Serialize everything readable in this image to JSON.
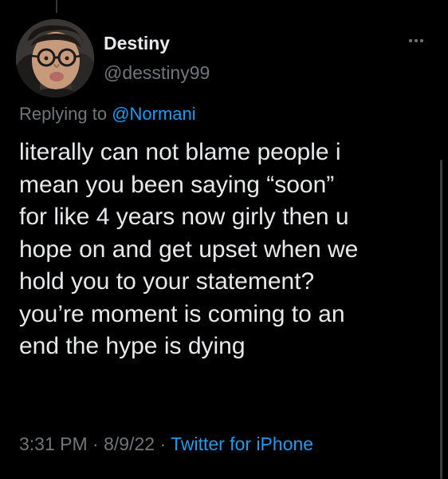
{
  "user": {
    "display_name": "Destiny",
    "handle": "@desstiny99",
    "avatar_icon": "profile-photo"
  },
  "reply": {
    "prefix": "Replying to ",
    "mention": "@Normani"
  },
  "tweet": {
    "lines": [
      "literally can not blame people i",
      "mean you been saying “soon”",
      "for like 4 years now girly then u",
      "hope on and get upset when we",
      "hold you to your statement?",
      "you’re moment is coming to an",
      "end the hype is dying"
    ]
  },
  "meta": {
    "time": "3:31 PM",
    "separator": " · ",
    "date": "8/9/22",
    "source": "Twitter for iPhone"
  },
  "icons": {
    "more": "more-icon"
  },
  "colors": {
    "background": "#000000",
    "text": "#e7e9ea",
    "secondary": "#71767b",
    "accent": "#1d9bf0"
  }
}
